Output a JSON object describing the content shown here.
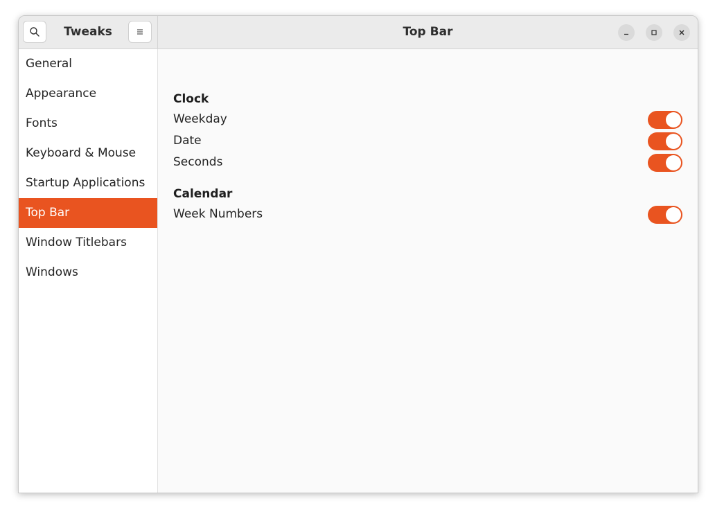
{
  "window": {
    "app_title": "Tweaks",
    "page_title": "Top Bar"
  },
  "header": {
    "search_icon": "search-icon",
    "menu_icon": "hamburger-menu-icon",
    "controls": [
      "minimize-icon",
      "maximize-icon",
      "close-icon"
    ]
  },
  "sidebar": {
    "items": [
      {
        "label": "General",
        "selected": false
      },
      {
        "label": "Appearance",
        "selected": false
      },
      {
        "label": "Fonts",
        "selected": false
      },
      {
        "label": "Keyboard & Mouse",
        "selected": false
      },
      {
        "label": "Startup Applications",
        "selected": false
      },
      {
        "label": "Top Bar",
        "selected": true
      },
      {
        "label": "Window Titlebars",
        "selected": false
      },
      {
        "label": "Windows",
        "selected": false
      }
    ]
  },
  "main": {
    "sections": [
      {
        "title": "Clock",
        "rows": [
          {
            "label": "Weekday",
            "enabled": true
          },
          {
            "label": "Date",
            "enabled": true
          },
          {
            "label": "Seconds",
            "enabled": true
          }
        ]
      },
      {
        "title": "Calendar",
        "rows": [
          {
            "label": "Week Numbers",
            "enabled": true
          }
        ]
      }
    ]
  },
  "colors": {
    "accent": "#e95420",
    "titlebar": "#ebebeb",
    "sidebar_bg": "#ffffff",
    "content_bg": "#fafafa"
  }
}
